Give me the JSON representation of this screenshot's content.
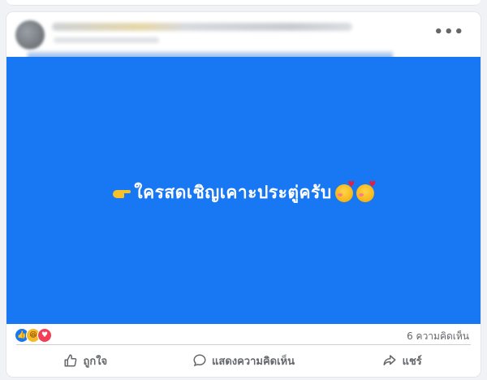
{
  "post": {
    "image_text": "ใครสดเชิญเคาะประตู่ครับ",
    "image_bg_color": "#1877f2",
    "emoji_leading": "backhand-index-pointing-right",
    "emoji_trailing": [
      "smiling-face-with-hearts",
      "smiling-face-with-hearts"
    ]
  },
  "reactions": {
    "icons": [
      "like",
      "haha",
      "love"
    ],
    "comment_count_label": "6 ความคิดเห็น"
  },
  "actions": {
    "like_label": "ถูกใจ",
    "comment_label": "แสดงความคิดเห็น",
    "share_label": "แชร์"
  }
}
